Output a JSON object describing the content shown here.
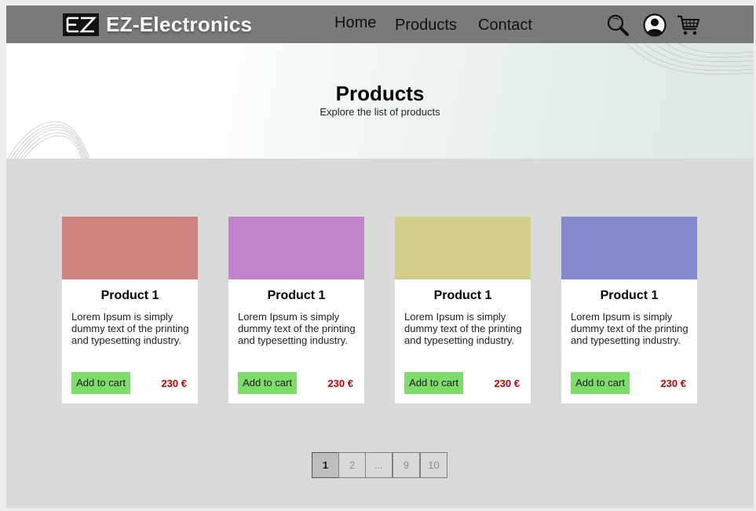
{
  "header": {
    "brand": "EZ-Electronics",
    "nav": {
      "home": "Home",
      "products": "Products",
      "contact": "Contact"
    },
    "icons": [
      "search-icon",
      "user-account-icon",
      "shopping-cart-icon"
    ]
  },
  "hero": {
    "title": "Products",
    "subtitle": "Explore the list of products"
  },
  "products": [
    {
      "name": "Product 1",
      "description": "Lorem Ipsum is simply dummy text of the printing and typesetting industry.",
      "button": "Add to cart",
      "price": "230 €",
      "color": "#cd8481"
    },
    {
      "name": "Product 1",
      "description": "Lorem Ipsum is simply dummy text of the printing and typesetting industry.",
      "button": "Add to cart",
      "price": "230 €",
      "color": "#c084cc"
    },
    {
      "name": "Product 1",
      "description": "Lorem Ipsum is simply dummy text of the printing and typesetting industry.",
      "button": "Add to cart",
      "price": "230 €",
      "color": "#cfcd88"
    },
    {
      "name": "Product 1",
      "description": "Lorem Ipsum is simply dummy text of the printing and typesetting industry.",
      "button": "Add to cart",
      "price": "230 €",
      "color": "#8589cd"
    }
  ],
  "pagination": {
    "pages": [
      "1",
      "2",
      "...",
      "9",
      "10"
    ],
    "current": "1"
  },
  "colors": {
    "header_bg": "#7a7a7a",
    "page_bg": "#d9d9d9",
    "button_green": "#7fdc6a",
    "price_red": "#c00000"
  }
}
